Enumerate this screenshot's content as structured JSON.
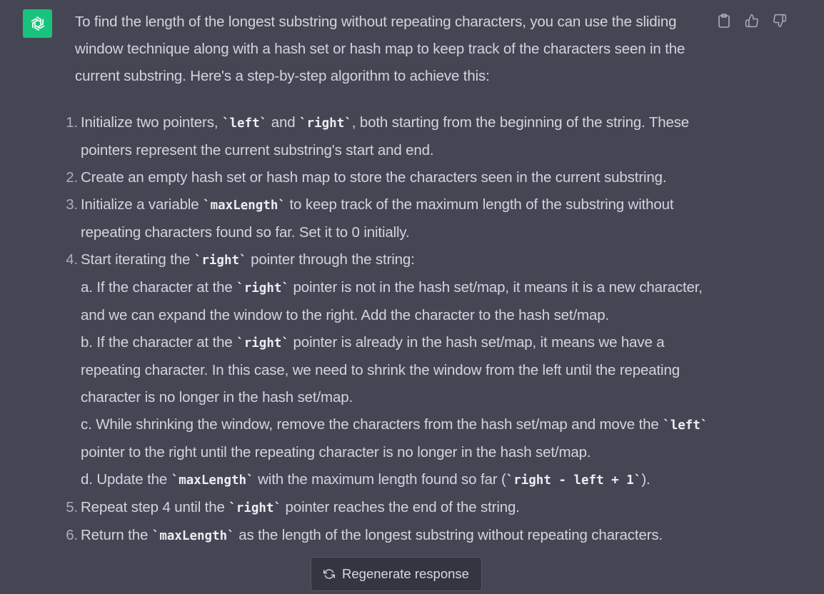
{
  "assistant": {
    "avatar_icon": "openai-logo-icon",
    "avatar_color": "#19c37d"
  },
  "actions": {
    "copy_icon": "clipboard-icon",
    "like_icon": "thumbs-up-icon",
    "dislike_icon": "thumbs-down-icon"
  },
  "message": {
    "intro": "To find the length of the longest substring without repeating characters, you can use the sliding window technique along with a hash set or hash map to keep track of the characters seen in the current substring. Here's a step-by-step algorithm to achieve this:",
    "steps": [
      {
        "num": "1.",
        "parts": [
          {
            "t": "Initialize two pointers, "
          },
          {
            "c": "`left`"
          },
          {
            "t": " and "
          },
          {
            "c": "`right`"
          },
          {
            "t": ", both starting from the beginning of the string. These pointers represent the current substring's start and end."
          }
        ]
      },
      {
        "num": "2.",
        "parts": [
          {
            "t": "Create an empty hash set or hash map to store the characters seen in the current substring."
          }
        ]
      },
      {
        "num": "3.",
        "parts": [
          {
            "t": "Initialize a variable "
          },
          {
            "c": "`maxLength`"
          },
          {
            "t": " to keep track of the maximum length of the substring without repeating characters found so far. Set it to 0 initially."
          }
        ]
      },
      {
        "num": "4.",
        "parts": [
          {
            "t": "Start iterating the "
          },
          {
            "c": "`right`"
          },
          {
            "t": " pointer through the string:"
          },
          {
            "br": true
          },
          {
            "t": "a. If the character at the "
          },
          {
            "c": "`right`"
          },
          {
            "t": " pointer is not in the hash set/map, it means it is a new character, and we can expand the window to the right. Add the character to the hash set/map."
          },
          {
            "br": true
          },
          {
            "t": "b. If the character at the "
          },
          {
            "c": "`right`"
          },
          {
            "t": " pointer is already in the hash set/map, it means we have a repeating character. In this case, we need to shrink the window from the left until the repeating character is no longer in the hash set/map."
          },
          {
            "br": true
          },
          {
            "t": "c. While shrinking the window, remove the characters from the hash set/map and move the "
          },
          {
            "c": "`left`"
          },
          {
            "t": " pointer to the right until the repeating character is no longer in the hash set/map."
          },
          {
            "br": true
          },
          {
            "t": "d. Update the "
          },
          {
            "c": "`maxLength`"
          },
          {
            "t": " with the maximum length found so far ("
          },
          {
            "c": "`right - left + 1`"
          },
          {
            "t": ")."
          }
        ]
      },
      {
        "num": "5.",
        "parts": [
          {
            "t": "Repeat step 4 until the "
          },
          {
            "c": "`right`"
          },
          {
            "t": " pointer reaches the end of the string."
          }
        ]
      },
      {
        "num": "6.",
        "parts": [
          {
            "t": "Return the "
          },
          {
            "c": "`maxLength`"
          },
          {
            "t": " as the length of the longest substring without repeating characters."
          }
        ]
      }
    ]
  },
  "regenerate": {
    "label": "Regenerate response",
    "icon": "refresh-icon"
  }
}
